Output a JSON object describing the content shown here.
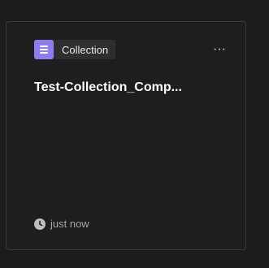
{
  "card": {
    "type_label": "Collection",
    "type_icon": "collection-icon",
    "accent_color": "#8e7cf0",
    "more_label": "···",
    "title": "Test-Collection_Comp...",
    "timestamp": "just now",
    "timestamp_icon": "clock-icon"
  }
}
